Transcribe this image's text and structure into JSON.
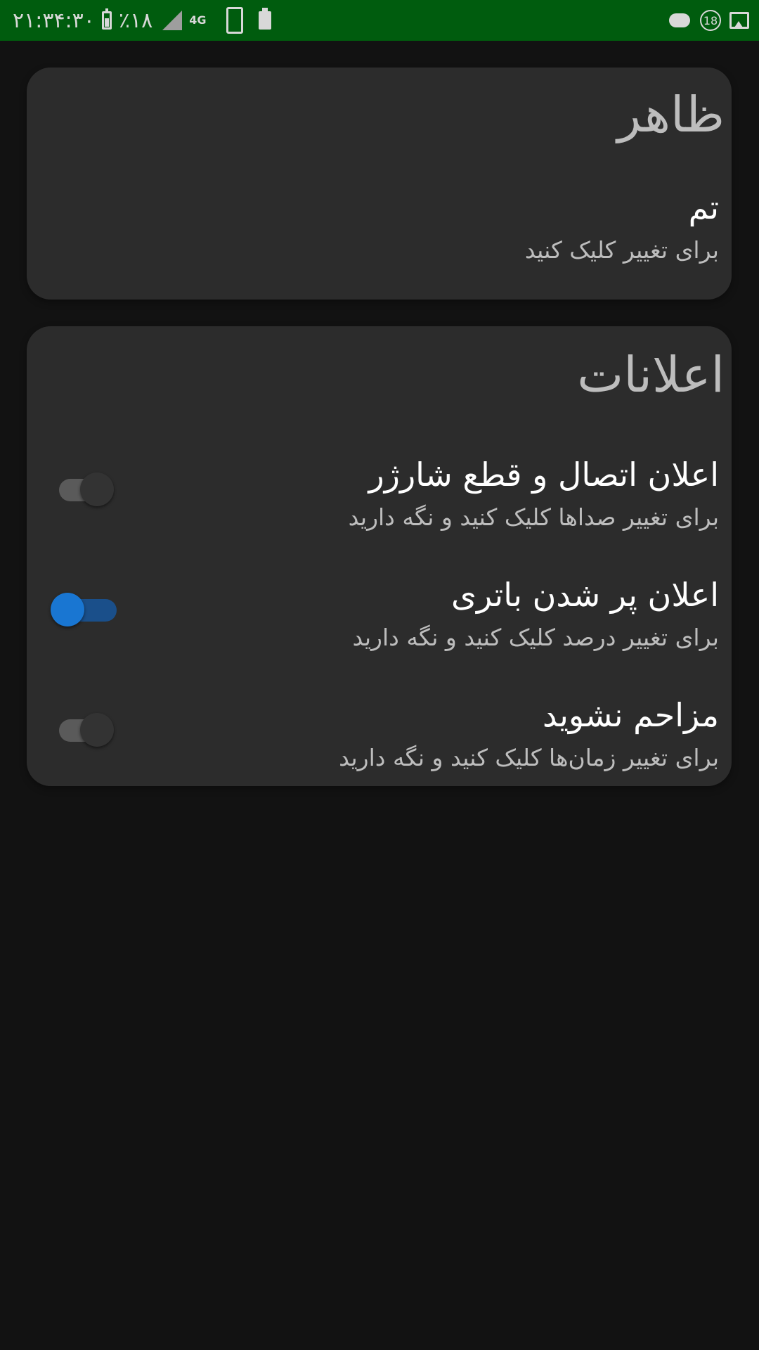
{
  "status_bar": {
    "time": "۲۱:۳۴:۳۰",
    "battery": "٪۱۸",
    "network": "4G",
    "notification_count": "18",
    "icons": [
      "battery-icon",
      "signal-icon",
      "network-4g-icon",
      "phone-icon",
      "battery-saver-icon",
      "cloud-icon",
      "notification-badge-icon",
      "image-icon"
    ]
  },
  "appearance": {
    "title": "ظاهر",
    "items": [
      {
        "title": "تم",
        "summary": "برای تغییر کلیک کنید"
      }
    ]
  },
  "notifications": {
    "title": "اعلانات",
    "items": [
      {
        "title": "اعلان اتصال و قطع شارژر",
        "summary": "برای تغییر صداها کلیک کنید و نگه دارید",
        "enabled": false
      },
      {
        "title": "اعلان پر شدن باتری",
        "summary": "برای تغییر درصد کلیک کنید و نگه دارید",
        "enabled": true
      },
      {
        "title": "مزاحم نشوید",
        "summary": "برای تغییر زمان‌ها کلیک کنید و نگه دارید",
        "enabled": false
      }
    ]
  },
  "colors": {
    "status_bar": "#005c0e",
    "background": "#121212",
    "card": "#2c2c2c",
    "accent": "#1976d2"
  }
}
